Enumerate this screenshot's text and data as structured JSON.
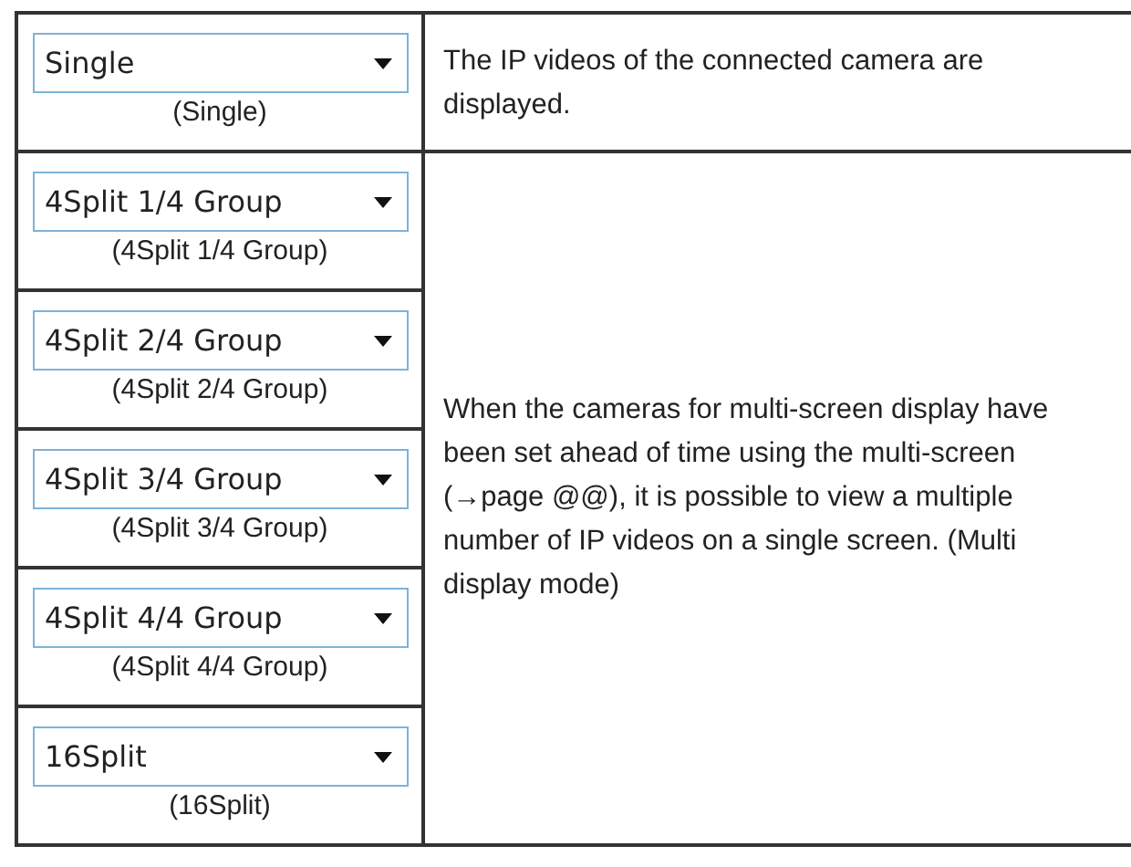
{
  "groups": [
    {
      "options": [
        {
          "dropdown": "Single",
          "caption": "(Single)"
        }
      ],
      "description": "The IP videos of the connected camera are displayed."
    },
    {
      "options": [
        {
          "dropdown": "4Split 1/4 Group",
          "caption": "(4Split 1/4 Group)"
        },
        {
          "dropdown": "4Split 2/4 Group",
          "caption": "(4Split 2/4 Group)"
        },
        {
          "dropdown": "4Split 3/4 Group",
          "caption": "(4Split 3/4 Group)"
        },
        {
          "dropdown": "4Split 4/4 Group",
          "caption": "(4Split 4/4 Group)"
        },
        {
          "dropdown": "16Split",
          "caption": "(16Split)"
        }
      ],
      "description": "When the cameras for multi-screen display have been set ahead of time using the multi-screen (→page @@), it is possible to view a multiple number of IP videos on a single screen. (Multi display mode)"
    }
  ]
}
